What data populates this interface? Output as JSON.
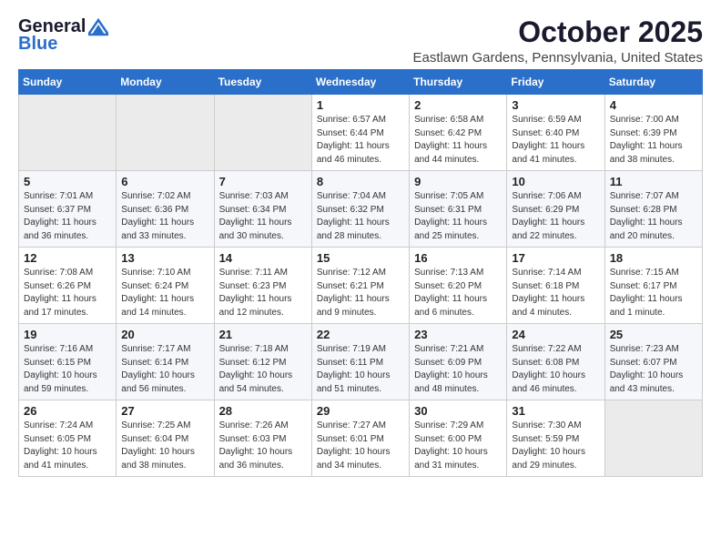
{
  "header": {
    "logo_line1": "General",
    "logo_line2": "Blue",
    "month": "October 2025",
    "location": "Eastlawn Gardens, Pennsylvania, United States"
  },
  "weekdays": [
    "Sunday",
    "Monday",
    "Tuesday",
    "Wednesday",
    "Thursday",
    "Friday",
    "Saturday"
  ],
  "weeks": [
    [
      {
        "day": "",
        "info": ""
      },
      {
        "day": "",
        "info": ""
      },
      {
        "day": "",
        "info": ""
      },
      {
        "day": "1",
        "info": "Sunrise: 6:57 AM\nSunset: 6:44 PM\nDaylight: 11 hours\nand 46 minutes."
      },
      {
        "day": "2",
        "info": "Sunrise: 6:58 AM\nSunset: 6:42 PM\nDaylight: 11 hours\nand 44 minutes."
      },
      {
        "day": "3",
        "info": "Sunrise: 6:59 AM\nSunset: 6:40 PM\nDaylight: 11 hours\nand 41 minutes."
      },
      {
        "day": "4",
        "info": "Sunrise: 7:00 AM\nSunset: 6:39 PM\nDaylight: 11 hours\nand 38 minutes."
      }
    ],
    [
      {
        "day": "5",
        "info": "Sunrise: 7:01 AM\nSunset: 6:37 PM\nDaylight: 11 hours\nand 36 minutes."
      },
      {
        "day": "6",
        "info": "Sunrise: 7:02 AM\nSunset: 6:36 PM\nDaylight: 11 hours\nand 33 minutes."
      },
      {
        "day": "7",
        "info": "Sunrise: 7:03 AM\nSunset: 6:34 PM\nDaylight: 11 hours\nand 30 minutes."
      },
      {
        "day": "8",
        "info": "Sunrise: 7:04 AM\nSunset: 6:32 PM\nDaylight: 11 hours\nand 28 minutes."
      },
      {
        "day": "9",
        "info": "Sunrise: 7:05 AM\nSunset: 6:31 PM\nDaylight: 11 hours\nand 25 minutes."
      },
      {
        "day": "10",
        "info": "Sunrise: 7:06 AM\nSunset: 6:29 PM\nDaylight: 11 hours\nand 22 minutes."
      },
      {
        "day": "11",
        "info": "Sunrise: 7:07 AM\nSunset: 6:28 PM\nDaylight: 11 hours\nand 20 minutes."
      }
    ],
    [
      {
        "day": "12",
        "info": "Sunrise: 7:08 AM\nSunset: 6:26 PM\nDaylight: 11 hours\nand 17 minutes."
      },
      {
        "day": "13",
        "info": "Sunrise: 7:10 AM\nSunset: 6:24 PM\nDaylight: 11 hours\nand 14 minutes."
      },
      {
        "day": "14",
        "info": "Sunrise: 7:11 AM\nSunset: 6:23 PM\nDaylight: 11 hours\nand 12 minutes."
      },
      {
        "day": "15",
        "info": "Sunrise: 7:12 AM\nSunset: 6:21 PM\nDaylight: 11 hours\nand 9 minutes."
      },
      {
        "day": "16",
        "info": "Sunrise: 7:13 AM\nSunset: 6:20 PM\nDaylight: 11 hours\nand 6 minutes."
      },
      {
        "day": "17",
        "info": "Sunrise: 7:14 AM\nSunset: 6:18 PM\nDaylight: 11 hours\nand 4 minutes."
      },
      {
        "day": "18",
        "info": "Sunrise: 7:15 AM\nSunset: 6:17 PM\nDaylight: 11 hours\nand 1 minute."
      }
    ],
    [
      {
        "day": "19",
        "info": "Sunrise: 7:16 AM\nSunset: 6:15 PM\nDaylight: 10 hours\nand 59 minutes."
      },
      {
        "day": "20",
        "info": "Sunrise: 7:17 AM\nSunset: 6:14 PM\nDaylight: 10 hours\nand 56 minutes."
      },
      {
        "day": "21",
        "info": "Sunrise: 7:18 AM\nSunset: 6:12 PM\nDaylight: 10 hours\nand 54 minutes."
      },
      {
        "day": "22",
        "info": "Sunrise: 7:19 AM\nSunset: 6:11 PM\nDaylight: 10 hours\nand 51 minutes."
      },
      {
        "day": "23",
        "info": "Sunrise: 7:21 AM\nSunset: 6:09 PM\nDaylight: 10 hours\nand 48 minutes."
      },
      {
        "day": "24",
        "info": "Sunrise: 7:22 AM\nSunset: 6:08 PM\nDaylight: 10 hours\nand 46 minutes."
      },
      {
        "day": "25",
        "info": "Sunrise: 7:23 AM\nSunset: 6:07 PM\nDaylight: 10 hours\nand 43 minutes."
      }
    ],
    [
      {
        "day": "26",
        "info": "Sunrise: 7:24 AM\nSunset: 6:05 PM\nDaylight: 10 hours\nand 41 minutes."
      },
      {
        "day": "27",
        "info": "Sunrise: 7:25 AM\nSunset: 6:04 PM\nDaylight: 10 hours\nand 38 minutes."
      },
      {
        "day": "28",
        "info": "Sunrise: 7:26 AM\nSunset: 6:03 PM\nDaylight: 10 hours\nand 36 minutes."
      },
      {
        "day": "29",
        "info": "Sunrise: 7:27 AM\nSunset: 6:01 PM\nDaylight: 10 hours\nand 34 minutes."
      },
      {
        "day": "30",
        "info": "Sunrise: 7:29 AM\nSunset: 6:00 PM\nDaylight: 10 hours\nand 31 minutes."
      },
      {
        "day": "31",
        "info": "Sunrise: 7:30 AM\nSunset: 5:59 PM\nDaylight: 10 hours\nand 29 minutes."
      },
      {
        "day": "",
        "info": ""
      }
    ]
  ]
}
